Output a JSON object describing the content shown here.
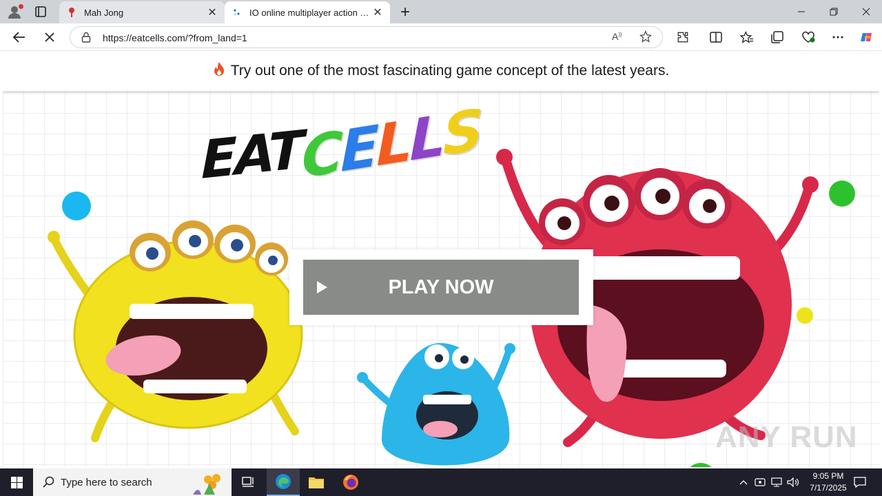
{
  "browser": {
    "tabs": [
      {
        "title": "Mah Jong",
        "active": false
      },
      {
        "title": "IO online multiplayer action game",
        "active": true
      }
    ],
    "url": "https://eatcells.com/?from_land=1"
  },
  "page": {
    "banner_text": "Try out one of the most fascinating game concept of the latest years.",
    "logo": {
      "word1": "EAT",
      "word2_letters": [
        {
          "ch": "C",
          "color": "#3fc93a"
        },
        {
          "ch": "E",
          "color": "#2b7de9"
        },
        {
          "ch": "L",
          "color": "#f25c1e"
        },
        {
          "ch": "L",
          "color": "#8e44c9"
        },
        {
          "ch": "S",
          "color": "#f0cf1c"
        }
      ]
    },
    "play_button_label": "PLAY NOW",
    "watermark": "ANY RUN",
    "colors": {
      "monster_yellow": "#f2e11f",
      "monster_red": "#e0314f",
      "monster_blue": "#2cb5e8",
      "dot_blue": "#1ab8f0",
      "dot_green": "#2ec12e",
      "dot_yellow": "#eee31a"
    }
  },
  "taskbar": {
    "search_placeholder": "Type here to search",
    "time": "9:05 PM",
    "date": "7/17/2025"
  }
}
